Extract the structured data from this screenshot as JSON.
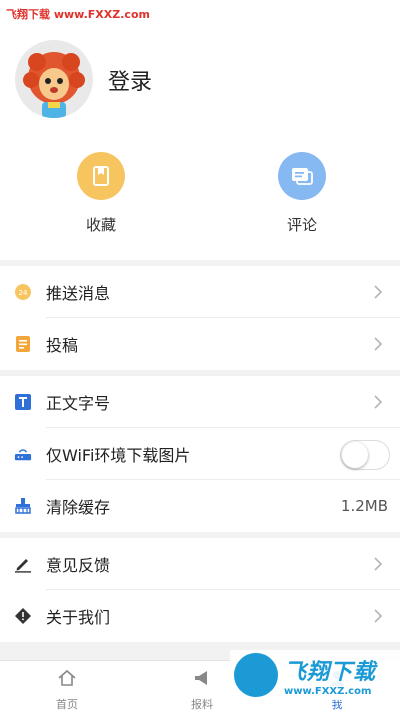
{
  "watermark_top": "飞翔下载 www.FXXZ.com",
  "profile": {
    "login_label": "登录"
  },
  "quick_actions": [
    {
      "label": "收藏",
      "icon": "bookmark-icon",
      "color": "#f6c560"
    },
    {
      "label": "评论",
      "icon": "comment-icon",
      "color": "#86b8f2"
    }
  ],
  "menu": {
    "push": {
      "label": "推送消息",
      "icon": "push-badge-icon",
      "badge": "24"
    },
    "submit": {
      "label": "投稿",
      "icon": "document-icon"
    },
    "font_size": {
      "label": "正文字号",
      "icon": "text-size-icon"
    },
    "wifi_images": {
      "label": "仅WiFi环境下载图片",
      "icon": "router-icon",
      "toggle": false
    },
    "clear_cache": {
      "label": "清除缓存",
      "icon": "broom-icon",
      "value": "1.2MB"
    },
    "feedback": {
      "label": "意见反馈",
      "icon": "pencil-icon"
    },
    "about": {
      "label": "关于我们",
      "icon": "info-diamond-icon"
    }
  },
  "tabbar": [
    {
      "label": "首页",
      "icon": "home-icon"
    },
    {
      "label": "报料",
      "icon": "megaphone-icon"
    },
    {
      "label": "我",
      "icon": "user-icon",
      "active": true
    }
  ],
  "watermark_bottom": {
    "title": "飞翔下载",
    "url": "www.FXXZ.com"
  },
  "colors": {
    "accent_blue": "#2e6fd8",
    "watermark_red": "#e0322c",
    "watermark_blue": "#1b9ad6"
  }
}
